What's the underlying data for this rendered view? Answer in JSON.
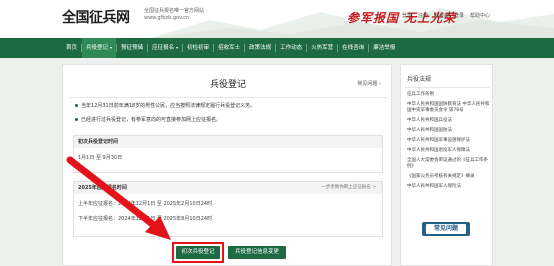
{
  "header": {
    "logo": "全国征兵网",
    "logo_sub_1": "全国征兵报名唯一官方网站",
    "logo_sub_2": "www.gfbzb.gov.cn",
    "slogan": "参军报国  无上光荣",
    "links": [
      "登录",
      "注册",
      "部委部门登录",
      "帮助中心"
    ]
  },
  "nav": {
    "items": [
      {
        "label": "首页",
        "active": false,
        "dropdown": false
      },
      {
        "label": "兵役登记",
        "active": true,
        "dropdown": true
      },
      {
        "label": "预征预储",
        "active": false,
        "dropdown": false
      },
      {
        "label": "应征报名",
        "active": false,
        "dropdown": true
      },
      {
        "label": "初检初审",
        "active": false,
        "dropdown": false
      },
      {
        "label": "招收军士",
        "active": false,
        "dropdown": false
      },
      {
        "label": "政策法规",
        "active": false,
        "dropdown": false
      },
      {
        "label": "工作动态",
        "active": false,
        "dropdown": false
      },
      {
        "label": "火热军营",
        "active": false,
        "dropdown": false
      },
      {
        "label": "在线咨询",
        "active": false,
        "dropdown": false
      },
      {
        "label": "廉洁举报",
        "active": false,
        "dropdown": false
      }
    ]
  },
  "main": {
    "title": "兵役登记",
    "faq_link": "常见问题",
    "notices": [
      "当年12月31日前年满18岁的男性公民，应当按照法律规定履行兵役登记义务。",
      "已经进行过兵役登记，有参军意向的可直接参加网上应征报名。"
    ],
    "first_registration": {
      "heading": "初次兵役登记时间",
      "period": "1月1日 至 9月30日"
    },
    "conscription": {
      "heading": "2025年应征报名时间",
      "link": "一步步教你网上应征报名 >",
      "first_half": "上半年应征报名：2024年12月1日 至 2025年2月10日24时",
      "second_half": "下半年应征报名：2024年12月1日 至 2025年8月10日24时"
    },
    "buttons": {
      "primary": "初次兵役登记",
      "secondary": "兵役登记信息变更"
    }
  },
  "sidebar": {
    "title": "兵役法规",
    "items": [
      "征兵工作条例",
      "中华人民共和国国防教育法 中华人民共和国中央军事委员会令 第78号",
      "中华人民共和国兵役法",
      "中华人民共和国国防法",
      "中华人民共和国军事设施保护法",
      "中华人民共和国退役军人保障法",
      "全国人大常委会审议通过的《征兵工作条例》",
      "《国家公务员考核有关规定》摘录",
      "中华人民共和国军人保险法"
    ],
    "banner": "常见问题"
  },
  "colors": {
    "nav_green": "#1e6b43",
    "nav_active": "#2f8a57",
    "highlight_red": "#e4131a",
    "banner_blue": "#25628a"
  }
}
